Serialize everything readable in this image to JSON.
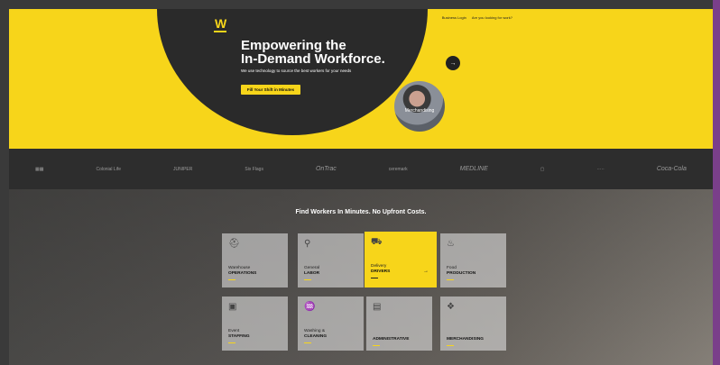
{
  "header": {
    "logo": "W",
    "nav": [
      "Business Login",
      "Are you looking for work?"
    ]
  },
  "hero": {
    "headline_line1": "Empowering the",
    "headline_line2": "In-Demand Workforce.",
    "subtext": "We use technology to source the best workers for your needs",
    "cta": "Fill Your Shift in Minutes",
    "photo_label": "Merchandising",
    "next_icon": "arrow-right-icon"
  },
  "brands": [
    "Colonial Life",
    "JUNIPER",
    "Six Flags",
    "OnTrac",
    "ceremark",
    "MEDLINE",
    "Coca-Cola"
  ],
  "workers": {
    "title": "Find Workers In Minutes. No Upfront Costs.",
    "tiles": [
      {
        "line1": "Warehouse",
        "line2": "OPERATIONS",
        "icon": "worker-icon"
      },
      {
        "line1": "General",
        "line2": "LABOR",
        "icon": "mover-icon"
      },
      {
        "line1": "Delivery",
        "line2": "DRIVERS",
        "icon": "truck-icon"
      },
      {
        "line1": "Food",
        "line2": "PRODUCTION",
        "icon": "cupcake-icon"
      },
      {
        "line1": "Event",
        "line2": "STAFFING",
        "icon": "event-icon"
      },
      {
        "line1": "Washing &",
        "line2": "CLEANING",
        "icon": "cleaning-icon"
      },
      {
        "line1": "",
        "line2": "ADMINISTRATIVE",
        "icon": "document-icon"
      },
      {
        "line1": "",
        "line2": "MERCHANDISING",
        "icon": "shelf-icon"
      }
    ],
    "active_tile": "Delivery DRIVERS"
  },
  "colors": {
    "accent": "#f7d51a",
    "dark": "#2a2a2a"
  }
}
